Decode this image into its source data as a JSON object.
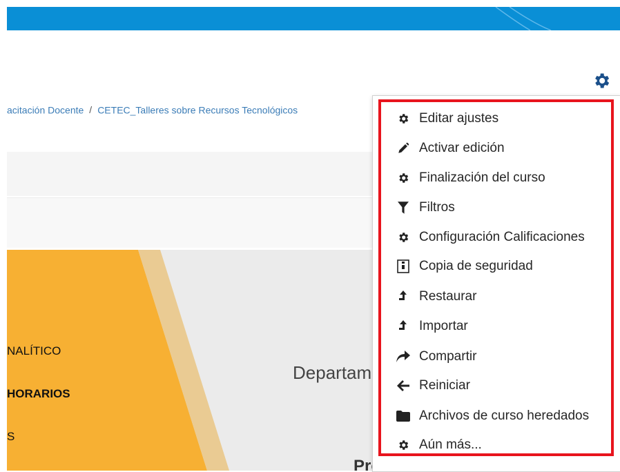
{
  "breadcrumb": {
    "items": [
      "acitación Docente",
      "CETEC_Talleres sobre Recursos Tecnológicos"
    ],
    "separator": "/"
  },
  "banner": {
    "lines": [
      "NALÍTICO",
      "HORARIOS",
      "S"
    ],
    "department": "Departam",
    "professor": "Profesor Responsable"
  },
  "menu": {
    "items": [
      {
        "label": "Editar ajustes",
        "icon": "gear-icon"
      },
      {
        "label": "Activar edición",
        "icon": "pencil-icon"
      },
      {
        "label": "Finalización del curso",
        "icon": "gear-icon"
      },
      {
        "label": "Filtros",
        "icon": "filter-icon"
      },
      {
        "label": "Configuración Calificaciones",
        "icon": "gear-icon"
      },
      {
        "label": "Copia de seguridad",
        "icon": "backup-file-icon"
      },
      {
        "label": "Restaurar",
        "icon": "upload-arrow-icon"
      },
      {
        "label": "Importar",
        "icon": "upload-arrow-icon"
      },
      {
        "label": "Compartir",
        "icon": "share-arrow-icon"
      },
      {
        "label": "Reiniciar",
        "icon": "arrow-left-icon"
      },
      {
        "label": "Archivos de curso heredados",
        "icon": "folder-icon"
      },
      {
        "label": "Aún más...",
        "icon": "gear-icon"
      }
    ]
  },
  "colors": {
    "topbar": "#0a8fd6",
    "link": "#3c7db7",
    "highlight": "#e8141d",
    "banner_orange": "#f7b033",
    "gear_blue": "#1a4f8a"
  }
}
